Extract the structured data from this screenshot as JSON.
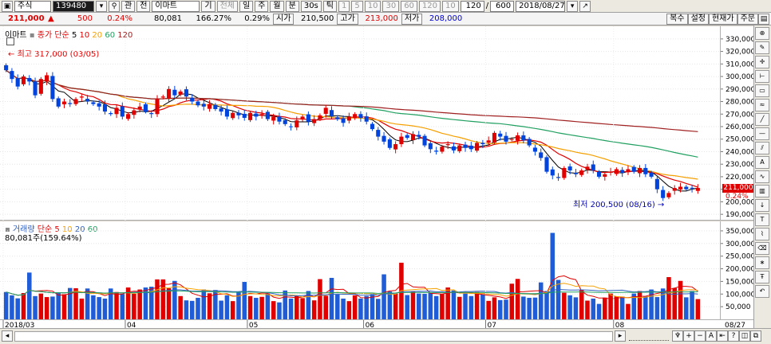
{
  "toolbar": {
    "market": "주식",
    "code": "139480",
    "name": "이마트",
    "buttons": [
      "관",
      "전",
      "기",
      "전체",
      "일",
      "주",
      "월",
      "분",
      "30s",
      "틱",
      "1",
      "5",
      "10",
      "30",
      "60",
      "120",
      "10"
    ],
    "count": "120",
    "total": "600",
    "date": "2018/08/27"
  },
  "quote": {
    "price": "211,000",
    "arrow": "▲",
    "change": "500",
    "change_pct": "0.24%",
    "volume": "80,081",
    "volume_ratio": "166.27%",
    "open_pct": "0.29%",
    "open_label": "시가",
    "open": "210,500",
    "high_label": "고가",
    "high": "213,000",
    "low_label": "저가",
    "low": "208,000",
    "actions": [
      "복수",
      "설정",
      "현재가",
      "주문"
    ]
  },
  "price_panel": {
    "legend_name": "이마트",
    "legend_series": "종가 단순",
    "ma_periods": [
      "5",
      "10",
      "20",
      "60",
      "120"
    ],
    "ma_colors": [
      "#000000",
      "#e00000",
      "#f5a000",
      "#20a060",
      "#a02020"
    ],
    "high_note": "최고 317,000 (03/05)",
    "low_note": "최저 200,500 (08/16)",
    "last_tag": "211,000",
    "last_pct": "0.24%"
  },
  "volume_panel": {
    "legend_name": "거래량",
    "legend_series": "단순",
    "ma_periods": [
      "5",
      "10",
      "20",
      "60"
    ],
    "value_note": "80,081주(159.64%)"
  },
  "chart_data": [
    {
      "type": "candlestick",
      "ylim": [
        185000,
        335000
      ],
      "yticks": [
        "330,000",
        "320,000",
        "310,000",
        "300,000",
        "290,000",
        "280,000",
        "270,000",
        "260,000",
        "250,000",
        "240,000",
        "230,000",
        "220,000",
        "210,000",
        "200,000",
        "190,000"
      ],
      "xticks": [
        "2018/03",
        "04",
        "05",
        "06",
        "07",
        "08",
        "08/27"
      ],
      "close": [
        305000,
        298000,
        292000,
        300000,
        296000,
        285000,
        298000,
        301000,
        282000,
        276000,
        280000,
        278000,
        282000,
        284000,
        280000,
        278000,
        276000,
        272000,
        270000,
        275000,
        268000,
        270000,
        273000,
        276000,
        272000,
        270000,
        282000,
        284000,
        290000,
        285000,
        288000,
        284000,
        280000,
        277000,
        276000,
        278000,
        274000,
        272000,
        268000,
        271000,
        269000,
        267000,
        271000,
        268000,
        270000,
        266000,
        268000,
        264000,
        262000,
        260000,
        265000,
        268000,
        264000,
        266000,
        269000,
        275000,
        268000,
        266000,
        263000,
        268000,
        270000,
        267000,
        264000,
        258000,
        252000,
        248000,
        243000,
        246000,
        252000,
        251000,
        254000,
        252000,
        245000,
        242000,
        240000,
        244000,
        246000,
        241000,
        245000,
        243000,
        242000,
        247000,
        246000,
        249000,
        255000,
        252000,
        248000,
        250000,
        253000,
        249000,
        245000,
        240000,
        235000,
        224000,
        221000,
        219000,
        227000,
        225000,
        222000,
        225000,
        228000,
        225000,
        220000,
        222000,
        224000,
        226000,
        223000,
        226000,
        224000,
        227000,
        222000,
        220000,
        210000,
        203000,
        207000,
        211000,
        212000,
        210000,
        210500,
        211000
      ],
      "ma_legend": [
        "5",
        "10",
        "20",
        "60",
        "120"
      ]
    },
    {
      "type": "bar",
      "name": "거래량",
      "ylim": [
        0,
        375000
      ],
      "yticks": [
        "350,000",
        "300,000",
        "250,000",
        "200,000",
        "150,000",
        "100,000",
        "50,000"
      ],
      "last_value": 80081,
      "values": [
        108000,
        95000,
        83000,
        104000,
        185000,
        92000,
        102000,
        88000,
        90000,
        104000,
        99000,
        124000,
        123000,
        82000,
        122000,
        95000,
        88000,
        82000,
        122000,
        108000,
        100000,
        126000,
        101000,
        118000,
        126000,
        129000,
        158000,
        158000,
        123000,
        152000,
        92000,
        75000,
        73000,
        85000,
        118000,
        103000,
        116000,
        74000,
        95000,
        72000,
        106000,
        148000,
        92000,
        85000,
        89000,
        102000,
        72000,
        67000,
        114000,
        82000,
        92000,
        84000,
        112000,
        75000,
        159000,
        93000,
        164000,
        98000,
        82000,
        72000,
        95000,
        82000,
        92000,
        100000,
        81000,
        178000,
        110000,
        101000,
        224000,
        96000,
        110000,
        102000,
        101000,
        104000,
        92000,
        101000,
        126000,
        114000,
        89000,
        102000,
        92000,
        108000,
        99000,
        73000,
        87000,
        76000,
        78000,
        141000,
        160000,
        90000,
        85000,
        86000,
        146000,
        112000,
        342000,
        156000,
        105000,
        95000,
        87000,
        117000,
        74000,
        82000,
        61000,
        86000,
        102000,
        91000,
        90000,
        61000,
        102000,
        112000,
        92000,
        118000,
        88000,
        122000,
        167000,
        124000,
        152000,
        87000,
        112000,
        80081
      ]
    }
  ]
}
